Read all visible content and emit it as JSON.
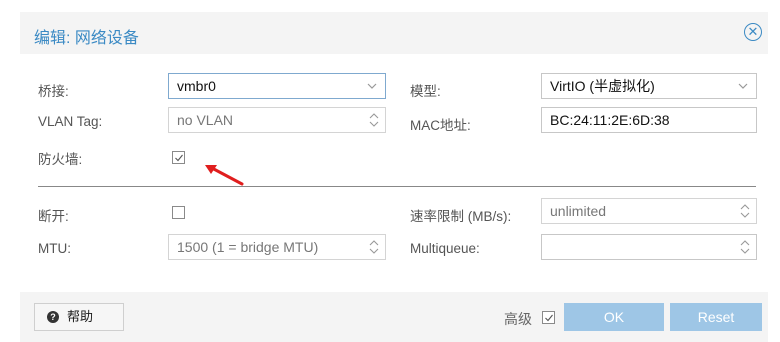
{
  "dialog": {
    "title": "编辑: 网络设备"
  },
  "form": {
    "bridge": {
      "label": "桥接:",
      "value": "vmbr0"
    },
    "vlan": {
      "label": "VLAN Tag:",
      "placeholder": "no VLAN"
    },
    "firewall": {
      "label": "防火墙:",
      "checked": true
    },
    "model": {
      "label": "模型:",
      "value": "VirtIO (半虚拟化)"
    },
    "mac": {
      "label": "MAC地址:",
      "value": "BC:24:11:2E:6D:38"
    },
    "disconnect": {
      "label": "断开:",
      "checked": false
    },
    "mtu": {
      "label": "MTU:",
      "placeholder": "1500 (1 = bridge MTU)"
    },
    "rate_limit": {
      "label": "速率限制 (MB/s):",
      "placeholder": "unlimited"
    },
    "multiqueue": {
      "label": "Multiqueue:",
      "value": ""
    }
  },
  "footer": {
    "help_label": "帮助",
    "advanced_label": "高级",
    "advanced_checked": true,
    "ok_label": "OK",
    "reset_label": "Reset"
  },
  "colors": {
    "accent": "#3b8ac4",
    "button_disabled": "#9ec6e6",
    "annotation_arrow": "#e01e1e"
  }
}
